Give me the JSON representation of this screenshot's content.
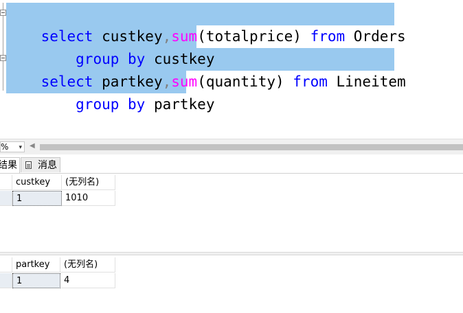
{
  "editor": {
    "line1": {
      "kw1": "select",
      "t1": " custkey",
      "comma": ",",
      "fn": "sum",
      "t2": "(totalprice)",
      "t3": " ",
      "kw2": "from",
      "t4": " Orders"
    },
    "line2": {
      "indent": "    ",
      "kw1": "group",
      "t1": " ",
      "kw2": "by",
      "t2": " custkey"
    },
    "line3": {
      "kw1": "select",
      "t1": " partkey",
      "comma": ",",
      "fn": "sum",
      "t2": "(quantity)",
      "t3": " ",
      "kw2": "from",
      "t4": " Lineitem"
    },
    "line4": {
      "indent": "    ",
      "kw1": "group",
      "t1": " ",
      "kw2": "by",
      "t2": " partkey"
    }
  },
  "toolbar": {
    "zoom": "%",
    "zoom_arrow": "▾",
    "scroll_left": "◀"
  },
  "tabs": {
    "results": "结果",
    "messages": "消息"
  },
  "results": [
    {
      "columns": [
        "custkey",
        "(无列名)"
      ],
      "rows": [
        [
          "1",
          "1010"
        ]
      ]
    },
    {
      "columns": [
        "partkey",
        "(无列名)"
      ],
      "rows": [
        [
          "1",
          "4"
        ]
      ]
    }
  ],
  "colors": {
    "selection": "#99c9ef",
    "keyword": "#0000ff",
    "function": "#ff00ff"
  }
}
